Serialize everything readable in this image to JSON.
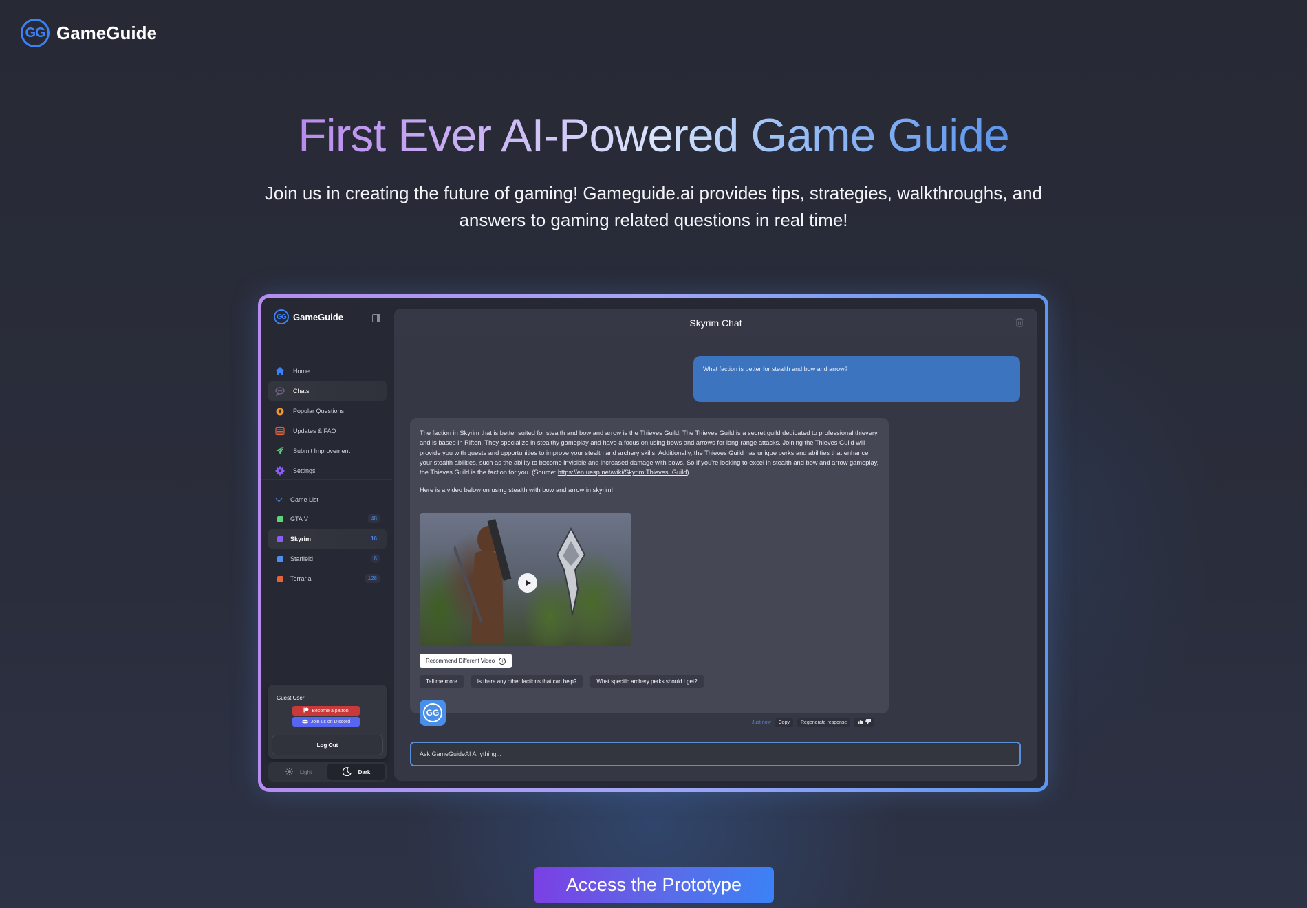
{
  "site": {
    "logo_text": "GG",
    "brand": "GameGuide"
  },
  "hero": {
    "title": "First Ever AI-Powered Game Guide",
    "subtitle": "Join us in creating the future of gaming! Gameguide.ai provides tips, strategies, walkthroughs, and answers to gaming related questions in real time!"
  },
  "colors": {
    "accent_blue": "#3b82f6",
    "accent_purple": "#b68cf0",
    "user_bubble": "#3d74c0",
    "background": "#272935"
  },
  "app": {
    "sidebar": {
      "logo_text": "GG",
      "brand": "GameGuide",
      "nav": [
        {
          "label": "Home",
          "icon": "home-icon",
          "active": false
        },
        {
          "label": "Chats",
          "icon": "chat-icon",
          "active": true
        },
        {
          "label": "Popular Questions",
          "icon": "fire-icon",
          "active": false
        },
        {
          "label": "Updates & FAQ",
          "icon": "list-icon",
          "active": false
        },
        {
          "label": "Submit Improvement",
          "icon": "send-icon",
          "active": false
        },
        {
          "label": "Settings",
          "icon": "gear-icon",
          "active": false
        }
      ],
      "game_list_label": "Game List",
      "games": [
        {
          "name": "GTA V",
          "count": "48",
          "color": "#5fd37a",
          "active": false
        },
        {
          "name": "Skyrim",
          "count": "16",
          "color": "#8b5cf6",
          "active": true
        },
        {
          "name": "Starfield",
          "count": "8",
          "color": "#4b8ff0",
          "active": false
        },
        {
          "name": "Terraria",
          "count": "128",
          "color": "#e0663a",
          "active": false
        }
      ],
      "user": {
        "name": "Guest User",
        "patron_label": "Become a patron",
        "discord_label": "Join us on Discord",
        "logout_label": "Log Out"
      },
      "theme": {
        "light_label": "Light",
        "dark_label": "Dark",
        "selected": "Dark"
      }
    },
    "chat": {
      "title": "Skyrim Chat",
      "user_message": "What faction is better for stealth and bow and arrow?",
      "ai_message": "The faction in Skyrim that is better suited for stealth and bow and arrow is the Thieves Guild. The Thieves Guild is a secret guild dedicated to professional thievery and is based in Riften. They specialize in stealthy gameplay and have a focus on using bows and arrows for long-range attacks. Joining the Thieves Guild will provide you with quests and opportunities to improve your stealth and archery skills. Additionally, the Thieves Guild has unique perks and abilities that enhance your stealth abilities, such as the ability to become invisible and increased damage with bows. So if you're looking to excel in stealth and bow and arrow gameplay, the Thieves Guild is the faction for you. (Source: ",
      "source_link": "https://en.uesp.net/wiki/Skyrim:Thieves_Guild",
      "source_close": ")",
      "video_intro": "Here is a video below on using stealth with bow and arrow in skyrim!",
      "recommend_label": "Recommend Different Video",
      "suggestions": [
        "Tell me more",
        "Is there any other factions that can help?",
        "What specific archery perks should I get?"
      ],
      "avatar_text": "GG",
      "timestamp": "Just now",
      "copy_label": "Copy",
      "regenerate_label": "Regenerate response",
      "input_placeholder": "Ask GameGuideAI Anything..."
    }
  },
  "cta": {
    "label": "Access the Prototype"
  }
}
